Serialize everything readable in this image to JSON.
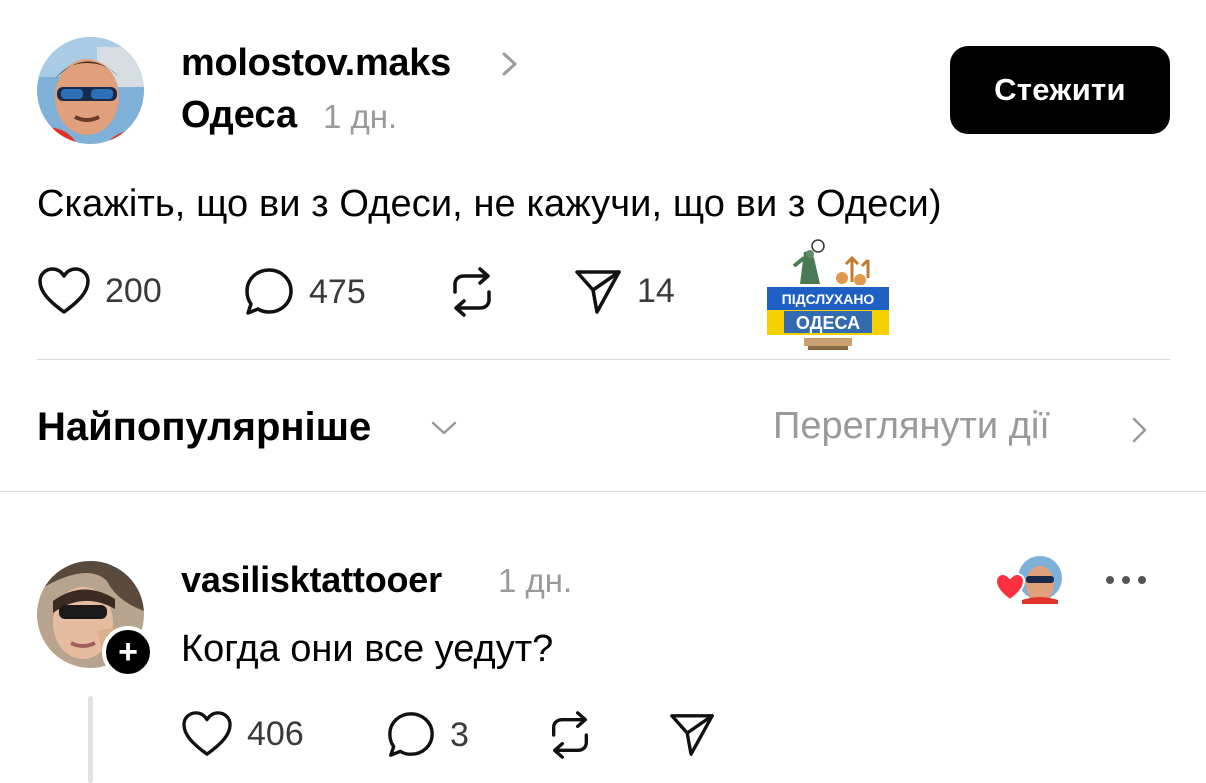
{
  "post": {
    "username": "molostov.maks",
    "location": "Одеса",
    "time": "1 дн.",
    "follow_label": "Стежити",
    "text": "Скажіть, що ви з Одеси, не кажучи, що ви з Одеси)",
    "likes": "200",
    "comments": "475",
    "shares": "14"
  },
  "sticker": {
    "line1": "ПІДСЛУХАНО",
    "line2": "ОДЕСА"
  },
  "sort": {
    "label": "Найпопулярніше",
    "view_activity": "Переглянути дії"
  },
  "comment": {
    "username": "vasilisktattooer",
    "time": "1 дн.",
    "text": "Когда они все уедут?",
    "likes": "406",
    "replies": "3"
  },
  "colors": {
    "accent": "#000000",
    "muted": "#9a9a9a",
    "heart": "#ff3040",
    "ukraine_blue": "#1e5fc4",
    "ukraine_yellow": "#f5d000"
  }
}
